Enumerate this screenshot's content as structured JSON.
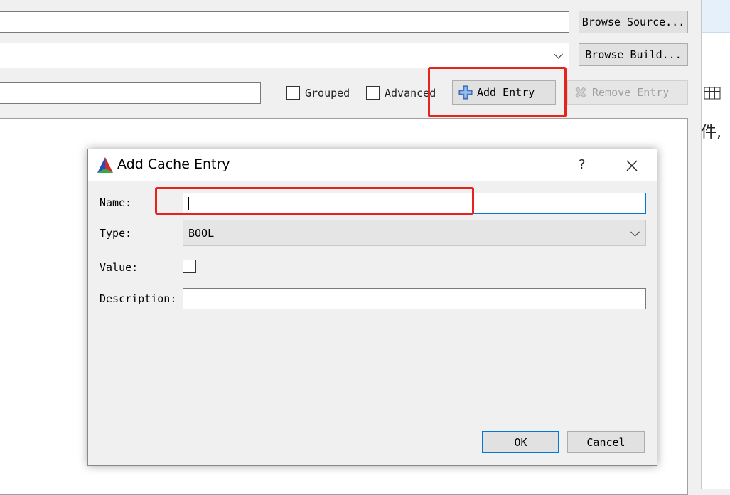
{
  "toolbar": {
    "browse_source": "Browse Source...",
    "browse_build": "Browse Build...",
    "grouped_label": "Grouped",
    "advanced_label": "Advanced",
    "add_entry": "Add Entry",
    "remove_entry": "Remove Entry"
  },
  "background_text": "件,",
  "dialog": {
    "title": "Add Cache Entry",
    "help": "?",
    "name_label": "Name:",
    "name_value": "",
    "type_label": "Type:",
    "type_value": "BOOL",
    "value_label": "Value:",
    "value_checked": false,
    "description_label": "Description:",
    "description_value": "",
    "ok": "OK",
    "cancel": "Cancel"
  },
  "colors": {
    "highlight": "#e8231b",
    "focus_border": "#0078d7",
    "window_bg": "#f0f0f0"
  },
  "icons": [
    "add-plus-icon",
    "remove-x-icon",
    "cmake-logo-icon",
    "close-icon",
    "chevron-down-icon",
    "table-grid-icon"
  ]
}
